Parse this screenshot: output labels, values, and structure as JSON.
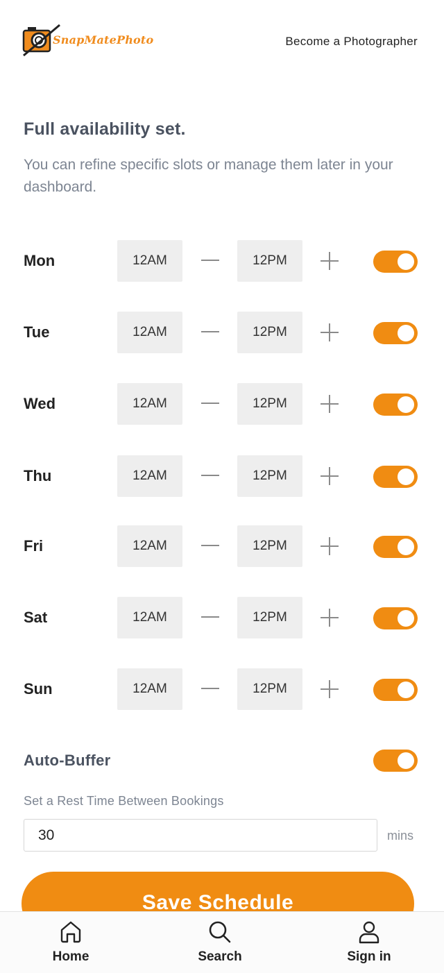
{
  "header": {
    "logo_text": "SnapMatePhoto",
    "become_link": "Become a Photographer"
  },
  "intro": {
    "title": "Full availability set.",
    "subtitle": "You can refine specific slots or manage them later in your dashboard."
  },
  "schedule": [
    {
      "day": "Mon",
      "start": "12AM",
      "end": "12PM",
      "enabled": true
    },
    {
      "day": "Tue",
      "start": "12AM",
      "end": "12PM",
      "enabled": true
    },
    {
      "day": "Wed",
      "start": "12AM",
      "end": "12PM",
      "enabled": true
    },
    {
      "day": "Thu",
      "start": "12AM",
      "end": "12PM",
      "enabled": true
    },
    {
      "day": "Fri",
      "start": "12AM",
      "end": "12PM",
      "enabled": true
    },
    {
      "day": "Sat",
      "start": "12AM",
      "end": "12PM",
      "enabled": true
    },
    {
      "day": "Sun",
      "start": "12AM",
      "end": "12PM",
      "enabled": true
    }
  ],
  "buffer": {
    "label": "Auto-Buffer",
    "enabled": true,
    "rest_label": "Set a Rest Time Between Bookings",
    "rest_value": "30",
    "unit": "mins"
  },
  "save_button": "Save Schedule",
  "nav": {
    "home": "Home",
    "search": "Search",
    "signin": "Sign in"
  },
  "colors": {
    "accent": "#f08c12",
    "time_box": "#eeeeee",
    "heading": "#4a5260",
    "muted": "#7d8592"
  },
  "icons": {
    "logo": "camera-logo-icon",
    "add": "plus-icon",
    "home": "home-icon",
    "search": "search-icon",
    "signin": "user-icon"
  }
}
